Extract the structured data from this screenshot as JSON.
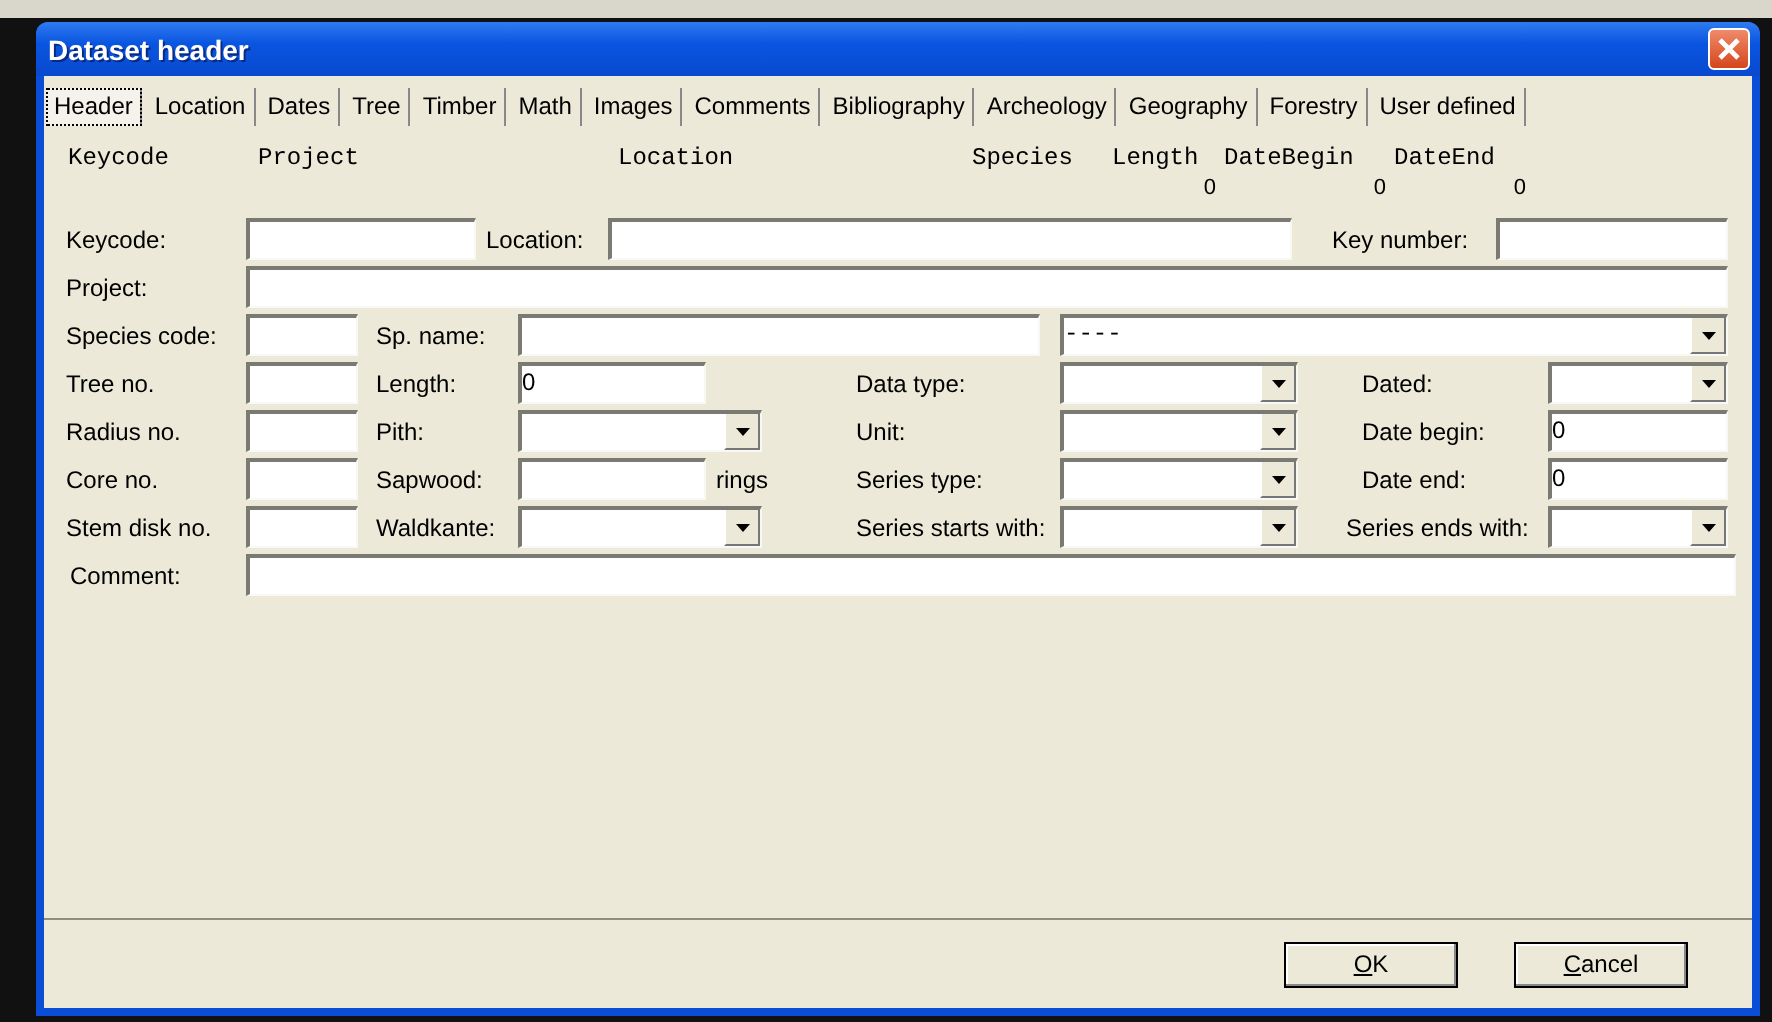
{
  "window": {
    "title": "Dataset header"
  },
  "tabs": [
    {
      "label": "Header",
      "selected": true
    },
    {
      "label": "Location",
      "selected": false
    },
    {
      "label": "Dates",
      "selected": false
    },
    {
      "label": "Tree",
      "selected": false
    },
    {
      "label": "Timber",
      "selected": false
    },
    {
      "label": "Math",
      "selected": false
    },
    {
      "label": "Images",
      "selected": false
    },
    {
      "label": "Comments",
      "selected": false
    },
    {
      "label": "Bibliography",
      "selected": false
    },
    {
      "label": "Archeology",
      "selected": false
    },
    {
      "label": "Geography",
      "selected": false
    },
    {
      "label": "Forestry",
      "selected": false
    },
    {
      "label": "User defined",
      "selected": false
    }
  ],
  "summary": [
    {
      "heading": "Keycode"
    },
    {
      "heading": "Project"
    },
    {
      "heading": "Location"
    },
    {
      "heading": "Species"
    },
    {
      "heading": "Length",
      "value": "0"
    },
    {
      "heading": "DateBegin",
      "value": "0"
    },
    {
      "heading": "DateEnd",
      "value": "0"
    }
  ],
  "form": [
    [
      {
        "kind": "label",
        "text": "Keycode:"
      },
      {
        "kind": "field"
      },
      {
        "kind": "label",
        "text": "Location:"
      },
      {
        "kind": "field"
      },
      {
        "kind": "label",
        "text": "Key number:"
      },
      {
        "kind": "field"
      }
    ],
    [
      {
        "kind": "label",
        "text": "Project:"
      },
      {
        "kind": "field"
      }
    ],
    [
      {
        "kind": "label",
        "text": "Species code:"
      },
      {
        "kind": "field"
      },
      {
        "kind": "label",
        "text": "Sp. name:"
      },
      {
        "kind": "field"
      },
      {
        "kind": "combo",
        "value": "----"
      }
    ],
    [
      {
        "kind": "label",
        "text": "Tree no."
      },
      {
        "kind": "field"
      },
      {
        "kind": "label",
        "text": "Length:"
      },
      {
        "kind": "field",
        "value": "0"
      },
      {
        "kind": "label",
        "text": "Data type:"
      },
      {
        "kind": "combo"
      },
      {
        "kind": "label",
        "text": "Dated:"
      },
      {
        "kind": "combo"
      }
    ],
    [
      {
        "kind": "label",
        "text": "Radius no."
      },
      {
        "kind": "field"
      },
      {
        "kind": "label",
        "text": "Pith:"
      },
      {
        "kind": "combo"
      },
      {
        "kind": "label",
        "text": "Unit:"
      },
      {
        "kind": "combo"
      },
      {
        "kind": "label",
        "text": "Date begin:"
      },
      {
        "kind": "field",
        "value": "0"
      }
    ],
    [
      {
        "kind": "label",
        "text": "Core no."
      },
      {
        "kind": "field"
      },
      {
        "kind": "label",
        "text": "Sapwood:"
      },
      {
        "kind": "field"
      },
      {
        "kind": "label",
        "text": "rings"
      },
      {
        "kind": "label",
        "text": "Series type:"
      },
      {
        "kind": "combo"
      },
      {
        "kind": "label",
        "text": "Date end:"
      },
      {
        "kind": "field",
        "value": "0"
      }
    ],
    [
      {
        "kind": "label",
        "text": "Stem disk no."
      },
      {
        "kind": "field"
      },
      {
        "kind": "label",
        "text": "Waldkante:"
      },
      {
        "kind": "combo"
      },
      {
        "kind": "label",
        "text": "Series starts with:"
      },
      {
        "kind": "combo"
      },
      {
        "kind": "label",
        "text": "Series ends with:"
      },
      {
        "kind": "combo"
      }
    ],
    [
      {
        "kind": "label",
        "text": "Comment:"
      },
      {
        "kind": "field"
      }
    ]
  ],
  "buttons": [
    {
      "label": "OK"
    },
    {
      "label": "Cancel"
    }
  ]
}
